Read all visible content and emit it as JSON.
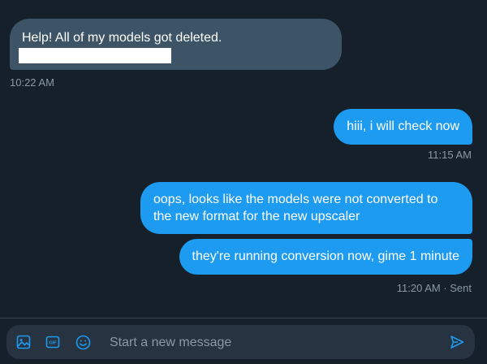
{
  "messages": [
    {
      "direction": "in",
      "text": "Help!  All of my models got deleted.",
      "time": "10:22 AM"
    },
    {
      "direction": "out",
      "text": "hiii, i will check now",
      "time": "11:15 AM"
    },
    {
      "direction": "out",
      "text": "oops, looks like the models were not converted to the new format for the new upscaler"
    },
    {
      "direction": "out",
      "text": "they're running conversion now, gime 1 minute",
      "time": "11:20 AM · Sent"
    }
  ],
  "composer": {
    "placeholder": "Start a new message",
    "icons": [
      "image-icon",
      "gif-icon",
      "emoji-icon",
      "send-icon"
    ],
    "gif_label": "GIF"
  },
  "colors": {
    "background": "#15202b",
    "incoming_bubble": "#3d5466",
    "outgoing_bubble": "#1d9bf0",
    "accent": "#1d9bf0",
    "muted_text": "#8b98a5",
    "composer_bg": "#273340"
  }
}
